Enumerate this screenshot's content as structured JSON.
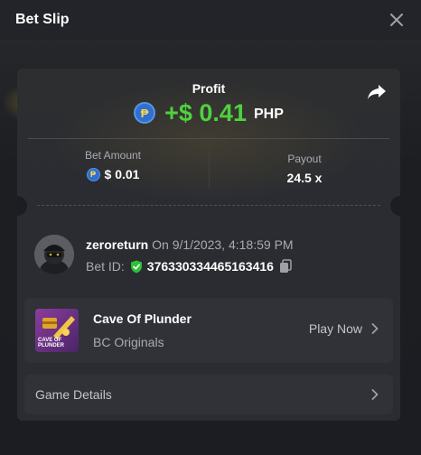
{
  "header": {
    "title": "Bet Slip"
  },
  "profit": {
    "label": "Profit",
    "value": "+$ 0.41",
    "currency": "PHP",
    "coin_symbol": "₱"
  },
  "stats": {
    "bet_amount_label": "Bet Amount",
    "bet_amount_value": "$ 0.01",
    "payout_label": "Payout",
    "payout_value": "24.5 x"
  },
  "user": {
    "username": "zeroreturn",
    "date_text": "On 9/1/2023, 4:18:59 PM",
    "bet_id_label": "Bet ID:",
    "bet_id": "376330334465163416"
  },
  "game": {
    "name": "Cave Of Plunder",
    "provider": "BC Originals",
    "thumb_text_line1": "CAVE OF",
    "thumb_text_line2": "PLUNDER",
    "play_label": "Play Now"
  },
  "details": {
    "label": "Game Details"
  },
  "colors": {
    "profit_green": "#4ed23f",
    "coin_blue": "#2f6fd0",
    "shield_green": "#2ec135",
    "card_bg": "#2a2c31"
  },
  "icons": [
    "close-icon",
    "share-icon",
    "coin-icon",
    "shield-check-icon",
    "copy-icon",
    "chevron-right-icon"
  ]
}
